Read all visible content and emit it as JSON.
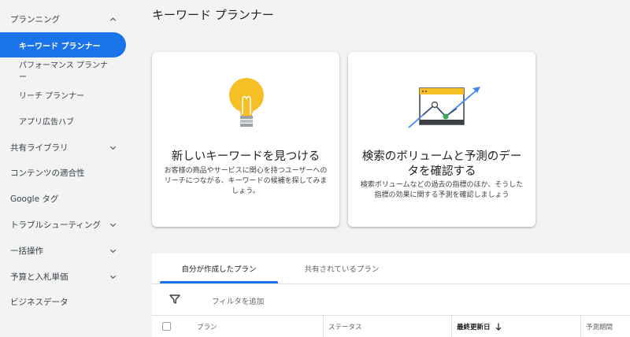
{
  "sidebar": {
    "planning": {
      "label": "プランニング"
    },
    "items": {
      "keyword_planner": "キーワード プランナー",
      "performance_planner": "パフォーマンス プランナ\nー",
      "reach_planner": "リーチ プランナー",
      "app_ad_hub": "アプリ広告ハブ"
    },
    "sections": [
      {
        "label": "共有ライブラリ"
      },
      {
        "label": "コンテンツの適合性"
      },
      {
        "label": "Google タグ"
      },
      {
        "label": "トラブルシューティング"
      },
      {
        "label": "一括操作"
      },
      {
        "label": "予算と入札単価"
      },
      {
        "label": "ビジネスデータ"
      }
    ]
  },
  "header": {
    "title": "キーワード プランナー"
  },
  "cards": [
    {
      "icon": "lightbulb-icon",
      "title": "新しいキーワードを見つける",
      "description": "お客様の商品やサービスに関心を持つユーザーへのリーチにつながる、キーワードの候補を探してみましょう。"
    },
    {
      "icon": "trend-chart-icon",
      "title": "検索のボリュームと予測のデータを確認する",
      "description": "検索ボリュームなどの過去の指標のほか、そうした指標の効果に関する予測を確認しましょう"
    }
  ],
  "plans": {
    "tabs": [
      "自分が作成したプラン",
      "共有されているプラン"
    ],
    "filter_label": "フィルタを追加",
    "columns": [
      "プラン",
      "ステータス",
      "最終更新日",
      "予測期間"
    ]
  },
  "colors": {
    "accent": "#1a73e8",
    "bulb": "#f6bf26"
  }
}
